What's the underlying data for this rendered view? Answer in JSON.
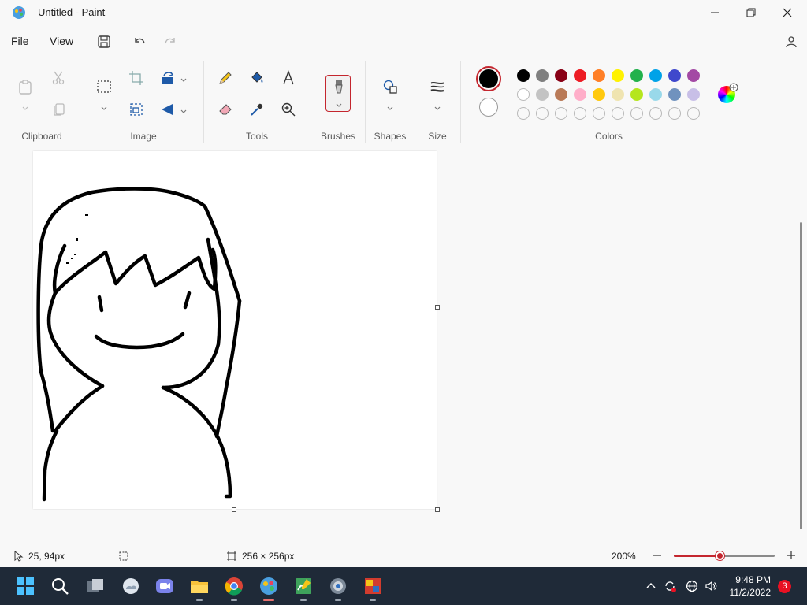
{
  "window": {
    "title": "Untitled - Paint"
  },
  "menu": {
    "file": "File",
    "view": "View"
  },
  "ribbon": {
    "groups": {
      "clipboard": "Clipboard",
      "image": "Image",
      "tools": "Tools",
      "brushes": "Brushes",
      "shapes": "Shapes",
      "size": "Size",
      "colors": "Colors"
    },
    "primary_color": "#000000",
    "secondary_color": "#ffffff",
    "palette_row1": [
      "#000000",
      "#7f7f7f",
      "#880015",
      "#ed1c24",
      "#ff7f27",
      "#fff200",
      "#22b14c",
      "#00a2e8",
      "#3f48cc",
      "#a349a4"
    ],
    "palette_row2": [
      "#ffffff",
      "#c3c3c3",
      "#b97a57",
      "#ffaec9",
      "#ffc90e",
      "#efe4b0",
      "#b5e61d",
      "#99d9ea",
      "#7092be",
      "#c8bfe7"
    ]
  },
  "status": {
    "cursor_pos": "25, 94px",
    "canvas_size": "256 × 256px",
    "zoom": "200%",
    "zoom_fraction": 0.45
  },
  "taskbar": {
    "time": "9:48 PM",
    "date": "11/2/2022",
    "notifications": "3"
  },
  "colors": {
    "accent": "#c4262e",
    "taskbar_bg": "#1f2a38"
  }
}
